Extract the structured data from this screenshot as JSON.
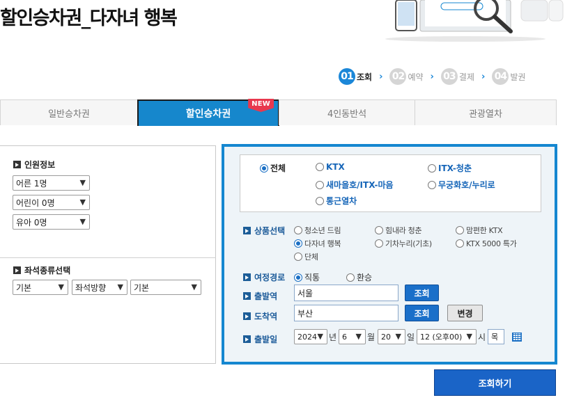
{
  "page_title": "할인승차권_다자녀 행복",
  "steps": [
    {
      "num": "01",
      "label": "조회",
      "active": true
    },
    {
      "num": "02",
      "label": "예약",
      "active": false
    },
    {
      "num": "03",
      "label": "결제",
      "active": false
    },
    {
      "num": "04",
      "label": "발권",
      "active": false
    }
  ],
  "tabs": [
    {
      "label": "일반승차권"
    },
    {
      "label": "할인승차권",
      "badge": "NEW"
    },
    {
      "label": "4인동반석"
    },
    {
      "label": "관광열차"
    }
  ],
  "passengers": {
    "title": "인원정보",
    "adult": "어른 1명",
    "child": "어린이 0명",
    "infant": "유아 0명"
  },
  "seat": {
    "title": "좌석종류선택",
    "type": "기본",
    "direction": "좌석방향",
    "position": "기본"
  },
  "train_types": {
    "all": "전체",
    "ktx": "KTX",
    "itx_cheongchun": "ITX-청춘",
    "saemaeul": "새마을호/ITX-마음",
    "mugunghwa": "무궁화호/누리로",
    "commuter": "통근열차",
    "selected": "전체"
  },
  "product": {
    "label": "상품선택",
    "options": {
      "youth_dream": "청소년 드림",
      "cheer_up": "힘내라 청춘",
      "comfy_ktx": "맘편한 KTX",
      "multi_child": "다자녀 행복",
      "gichanuri": "기차누리(기초)",
      "ktx5000": "KTX 5000 특가",
      "group": "단체"
    },
    "selected": "다자녀 행복"
  },
  "route": {
    "label": "여정경로",
    "direct": "직통",
    "transfer": "환승",
    "selected": "직통"
  },
  "departure": {
    "label": "출발역",
    "value": "서울",
    "button": "조회"
  },
  "arrival": {
    "label": "도착역",
    "value": "부산",
    "button": "조회",
    "swap": "변경"
  },
  "date": {
    "label": "출발일",
    "year": "2024",
    "year_unit": "년",
    "month": "6",
    "month_unit": "월",
    "day": "20",
    "day_unit": "일",
    "hour": "12 (오후00)",
    "hour_unit": "시",
    "weekday": "목"
  },
  "search_button": "조회하기",
  "colors": {
    "accent": "#1587d0",
    "button": "#1a64c7",
    "badge": "#e8384e"
  }
}
